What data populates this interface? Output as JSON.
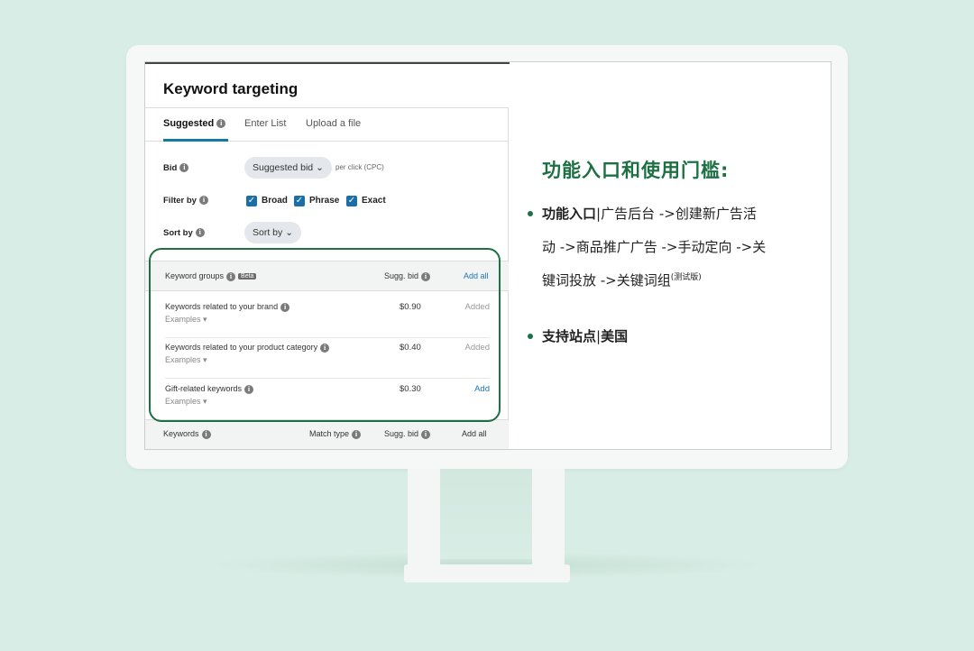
{
  "left_panel": {
    "title": "Keyword targeting",
    "tabs": [
      "Suggested",
      "Enter List",
      "Upload a file"
    ],
    "bid": {
      "label": "Bid",
      "dropdown": "Suggested bid",
      "per_click": "per click (CPC)"
    },
    "filter": {
      "label": "Filter by",
      "options": [
        "Broad",
        "Phrase",
        "Exact"
      ]
    },
    "sort": {
      "label": "Sort by",
      "dropdown": "Sort by"
    },
    "groups_header": {
      "col1": "Keyword groups",
      "badge": "Beta",
      "col2": "Sugg. bid",
      "action": "Add all"
    },
    "groups": [
      {
        "name": "Keywords related to your brand",
        "examples": "Examples",
        "bid": "$0.90",
        "status": "Added"
      },
      {
        "name": "Keywords related to your product category",
        "examples": "Examples",
        "bid": "$0.40",
        "status": "Added"
      },
      {
        "name": "Gift-related keywords",
        "examples": "Examples",
        "bid": "$0.30",
        "status": "Add"
      }
    ],
    "keywords_footer": {
      "col1": "Keywords",
      "col2": "Match type",
      "col3": "Sugg. bid",
      "action": "Add all"
    }
  },
  "right_panel": {
    "title": "功能入口和使用门槛:",
    "bullet1": {
      "bold": "功能入口",
      "sep": "|",
      "line1": "广告后台 ->创建新广告活",
      "line2": "动 ->商品推广广告 ->手动定向 ->关",
      "line3": "键词投放 ->关键词组",
      "sup": "(测试版)"
    },
    "bullet2": {
      "bold": "支持站点",
      "sep": "|",
      "bold2": "美国"
    }
  },
  "colors": {
    "accent": "#1d7043",
    "background": "#d8ede5",
    "link": "#1f77b4"
  }
}
